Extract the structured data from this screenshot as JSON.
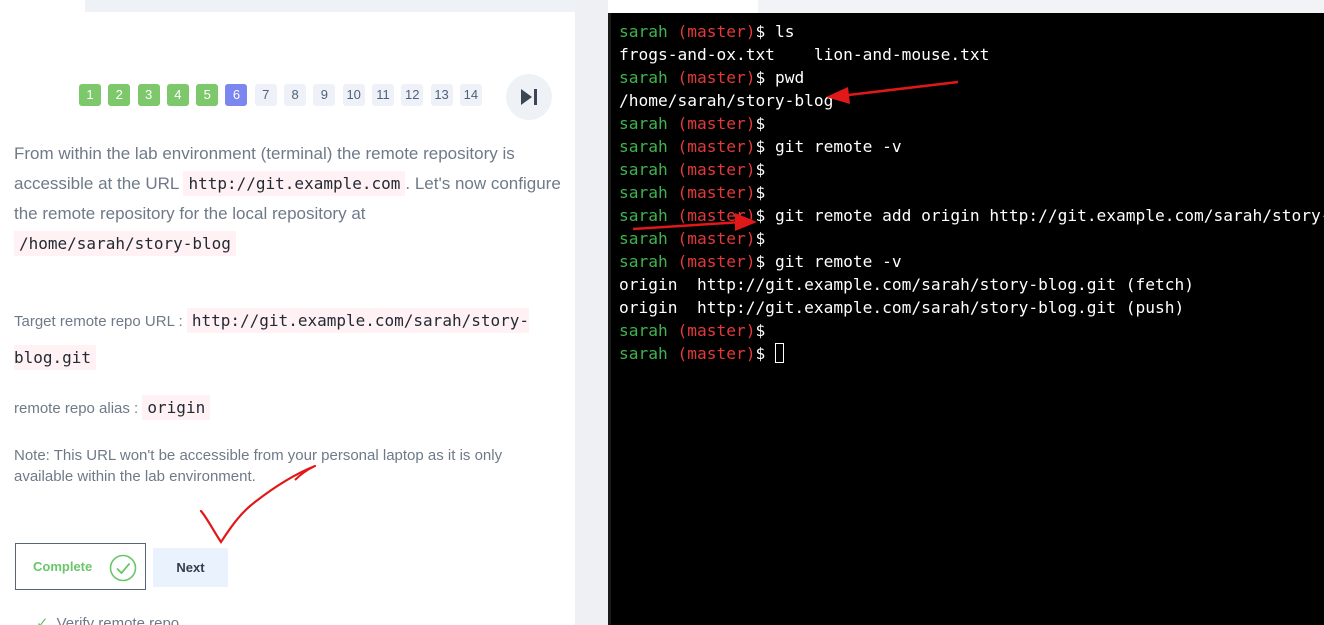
{
  "pager": {
    "pages": [
      {
        "label": "1",
        "state": "done"
      },
      {
        "label": "2",
        "state": "done"
      },
      {
        "label": "3",
        "state": "done"
      },
      {
        "label": "4",
        "state": "done"
      },
      {
        "label": "5",
        "state": "done"
      },
      {
        "label": "6",
        "state": "current"
      },
      {
        "label": "7",
        "state": "todo"
      },
      {
        "label": "8",
        "state": "todo"
      },
      {
        "label": "9",
        "state": "todo"
      },
      {
        "label": "10",
        "state": "todo"
      },
      {
        "label": "11",
        "state": "todo"
      },
      {
        "label": "12",
        "state": "todo"
      },
      {
        "label": "13",
        "state": "todo"
      },
      {
        "label": "14",
        "state": "todo"
      }
    ],
    "skip_icon": "skip-to-end-icon"
  },
  "content": {
    "intro_1": "From within the lab environment (terminal) the remote repository is accessible at the URL",
    "intro_url": "http://git.example.com",
    "intro_2": ". Let's now configure the remote repository for the local repository at",
    "intro_path": "/home/sarah/story-blog",
    "target_label": "Target remote repo URL :",
    "target_url": "http://git.example.com/sarah/story-blog.git",
    "alias_label": "remote repo alias :",
    "alias_value": "origin",
    "note": "Note: This URL won't be accessible from your personal laptop as it is only available within the lab environment."
  },
  "actions": {
    "complete_label": "Complete",
    "complete_icon": "check-circle-icon",
    "next_label": "Next"
  },
  "next_task": {
    "label": "Verify remote repo"
  },
  "terminal": {
    "lines": [
      {
        "user": "sarah",
        "branch": "(master)",
        "prompt": "$ ",
        "cmd": "ls"
      },
      {
        "output": "frogs-and-ox.txt    lion-and-mouse.txt"
      },
      {
        "user": "sarah",
        "branch": "(master)",
        "prompt": "$ ",
        "cmd": "pwd"
      },
      {
        "output": "/home/sarah/story-blog"
      },
      {
        "user": "sarah",
        "branch": "(master)",
        "prompt": "$",
        "cmd": ""
      },
      {
        "user": "sarah",
        "branch": "(master)",
        "prompt": "$ ",
        "cmd": "git remote -v"
      },
      {
        "user": "sarah",
        "branch": "(master)",
        "prompt": "$",
        "cmd": ""
      },
      {
        "user": "sarah",
        "branch": "(master)",
        "prompt": "$",
        "cmd": ""
      },
      {
        "user": "sarah",
        "branch": "(master)",
        "prompt": "$ ",
        "cmd": "git remote add origin http://git.example.com/sarah/story-blog.g"
      },
      {
        "user": "sarah",
        "branch": "(master)",
        "prompt": "$",
        "cmd": ""
      },
      {
        "user": "sarah",
        "branch": "(master)",
        "prompt": "$ ",
        "cmd": "git remote -v"
      },
      {
        "output": "origin  http://git.example.com/sarah/story-blog.git (fetch)"
      },
      {
        "output": "origin  http://git.example.com/sarah/story-blog.git (push)"
      },
      {
        "user": "sarah",
        "branch": "(master)",
        "prompt": "$",
        "cmd": ""
      },
      {
        "user": "sarah",
        "branch": "(master)",
        "prompt": "$ ",
        "cmd": "",
        "cursor": true
      }
    ]
  },
  "colors": {
    "done": "#7dc86b",
    "current": "#7b86ee",
    "user": "#3fb34f",
    "branch": "#e23a3a",
    "annotation": "#e01818"
  }
}
